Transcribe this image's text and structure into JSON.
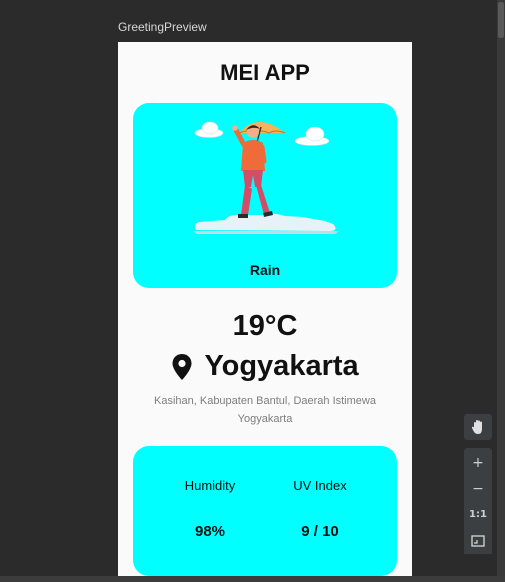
{
  "window": {
    "preview_label": "GreetingPreview"
  },
  "app": {
    "title": "MEI APP",
    "weather": {
      "condition": "Rain"
    },
    "temperature": "19°C",
    "location": {
      "city": "Yogyakarta",
      "address": "Kasihan, Kabupaten Bantul, Daerah Istimewa Yogyakarta"
    },
    "stats": {
      "humidity_label": "Humidity",
      "humidity_value": "98%",
      "uv_label": "UV Index",
      "uv_value": "9 / 10"
    },
    "colors": {
      "card": "#00ffff",
      "background": "#fafafa"
    }
  },
  "toolbar": {
    "pan_icon": "hand-icon",
    "zoom_in_label": "+",
    "zoom_out_label": "−",
    "actual_size_label": "1:1",
    "fit_icon": "fit-screen-icon"
  }
}
